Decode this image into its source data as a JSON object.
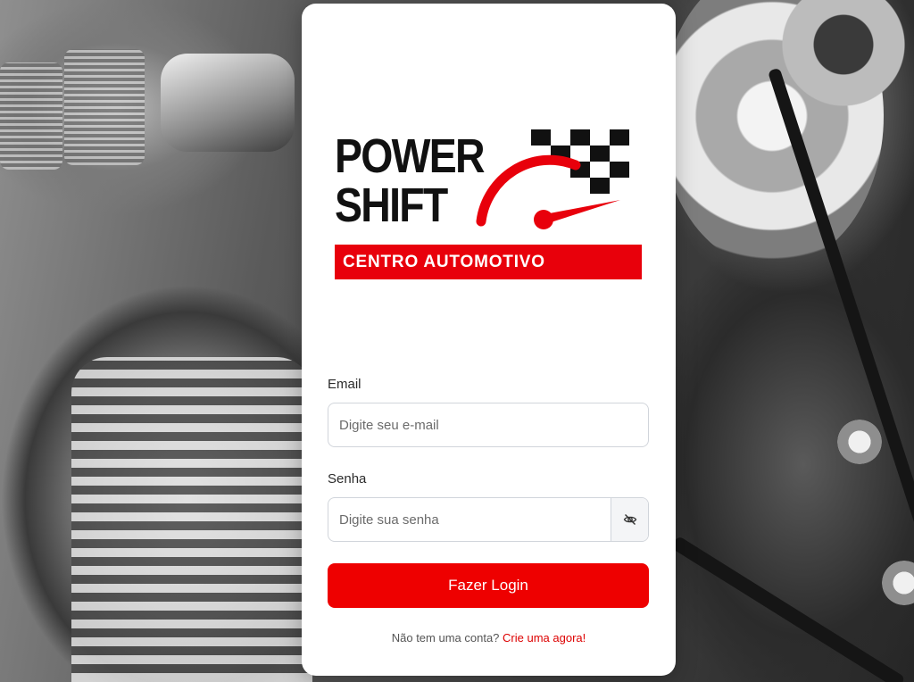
{
  "brand": {
    "line1": "POWER",
    "line2": "SHIFT",
    "tagline": "CENTRO AUTOMOTIVO",
    "accent_color": "#e8000b"
  },
  "form": {
    "email_label": "Email",
    "email_placeholder": "Digite seu e-mail",
    "password_label": "Senha",
    "password_placeholder": "Digite sua senha",
    "toggle_icon": "eye-slash-icon",
    "submit_label": "Fazer Login",
    "submit_color": "#ee0000"
  },
  "footer": {
    "prompt": "Não tem uma conta?",
    "link_label": "Crie uma agora!"
  }
}
